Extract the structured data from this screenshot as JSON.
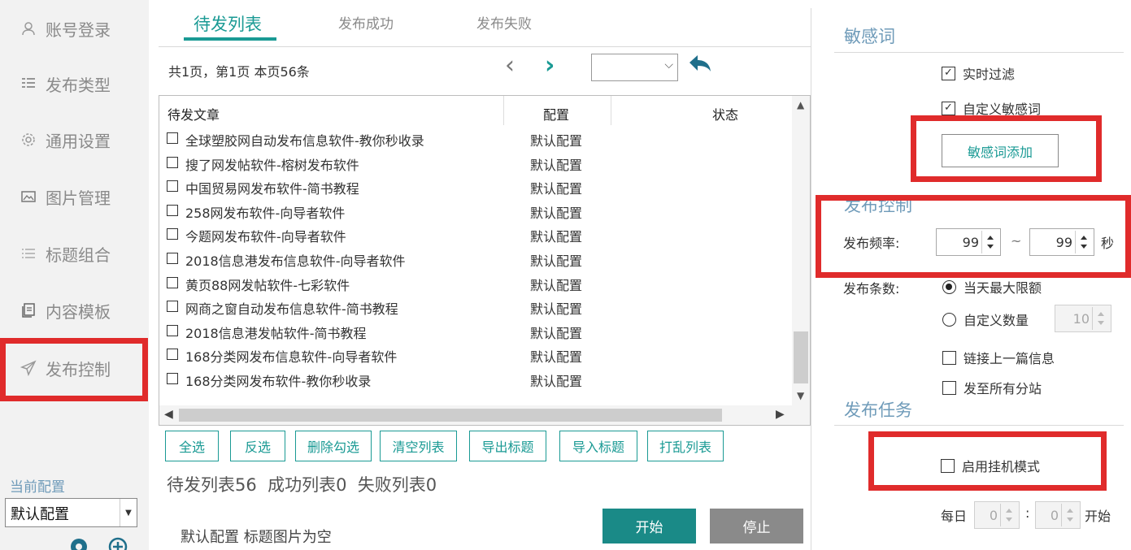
{
  "sidebar": {
    "items": [
      {
        "label": "账号登录",
        "icon": "user-icon"
      },
      {
        "label": "发布类型",
        "icon": "list-icon"
      },
      {
        "label": "通用设置",
        "icon": "gear-icon"
      },
      {
        "label": "图片管理",
        "icon": "image-icon"
      },
      {
        "label": "标题组合",
        "icon": "lines-icon"
      },
      {
        "label": "内容模板",
        "icon": "template-icon"
      },
      {
        "label": "发布控制",
        "icon": "send-icon"
      }
    ],
    "current_config_label": "当前配置",
    "current_config_value": "默认配置"
  },
  "tabs": [
    {
      "label": "待发列表"
    },
    {
      "label": "发布成功"
    },
    {
      "label": "发布失败"
    }
  ],
  "pager": {
    "info": "共1页，第1页 本页56条",
    "prev": "‹",
    "next": "›",
    "select_value": ""
  },
  "table": {
    "headers": {
      "article": "待发文章",
      "config": "配置",
      "status": "状态"
    },
    "rows": [
      {
        "title": "全球塑胶网自动发布信息软件-教你秒收录",
        "config": "默认配置"
      },
      {
        "title": "搜了网发帖软件-榕树发布软件",
        "config": "默认配置"
      },
      {
        "title": "中国贸易网发布软件-简书教程",
        "config": "默认配置"
      },
      {
        "title": "258网发布软件-向导者软件",
        "config": "默认配置"
      },
      {
        "title": "今题网发布软件-向导者软件",
        "config": "默认配置"
      },
      {
        "title": "2018信息港发布信息软件-向导者软件",
        "config": "默认配置"
      },
      {
        "title": "黄页88网发帖软件-七彩软件",
        "config": "默认配置"
      },
      {
        "title": "网商之窗自动发布信息软件-简书教程",
        "config": "默认配置"
      },
      {
        "title": "2018信息港发帖软件-简书教程",
        "config": "默认配置"
      },
      {
        "title": "168分类网发布信息软件-向导者软件",
        "config": "默认配置"
      },
      {
        "title": "168分类网发布软件-教你秒收录",
        "config": "默认配置"
      }
    ]
  },
  "buttons": {
    "select_all": "全选",
    "invert": "反选",
    "delete_checked": "删除勾选",
    "clear_list": "清空列表",
    "export_titles": "导出标题",
    "import_titles": "导入标题",
    "shuffle_list": "打乱列表",
    "start": "开始",
    "stop": "停止"
  },
  "counts": "待发列表56  成功列表0  失败列表0",
  "status_message": "默认配置 标题图片为空",
  "sensitive": {
    "title": "敏感词",
    "realtime_filter": "实时过滤",
    "custom_words": "自定义敏感词",
    "add_button": "敏感词添加"
  },
  "publish_control": {
    "title": "发布控制",
    "frequency_label": "发布频率:",
    "freq_min": "99",
    "separator": "~",
    "freq_max": "99",
    "unit": "秒",
    "count_label": "发布条数:",
    "option_daily_max": "当天最大限额",
    "option_custom": "自定义数量",
    "custom_count": "10",
    "link_previous": "链接上一篇信息",
    "send_all_branches": "发至所有分站"
  },
  "publish_task": {
    "title": "发布任务",
    "hangup_mode": "启用挂机模式",
    "daily_label": "每日",
    "hour": "0",
    "colon": ":",
    "minute": "0",
    "start_label": "开始"
  },
  "colors": {
    "accent": "#1a9a94",
    "highlight_red": "#e02b2b",
    "section_title": "#6f9bb9"
  }
}
